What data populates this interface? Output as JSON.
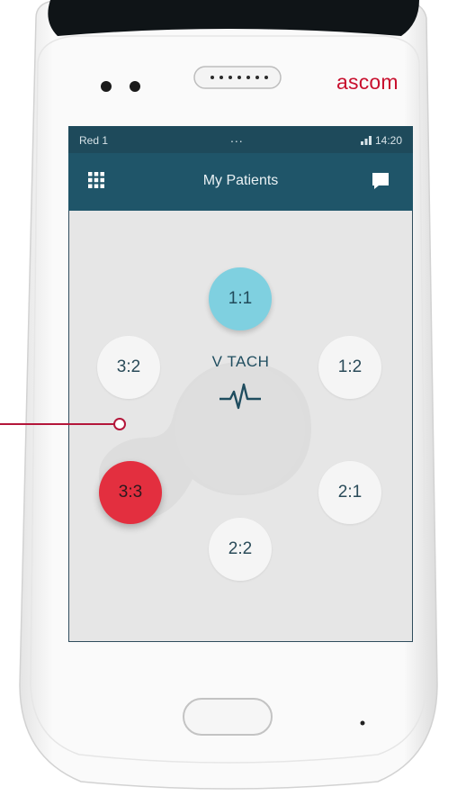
{
  "device": {
    "brand": "ascom",
    "brand_color": "#c8102e"
  },
  "status_bar": {
    "left": "Red 1",
    "middle": "...",
    "time": "14:20"
  },
  "app_bar": {
    "title": "My Patients",
    "left_icon": "grid-menu-icon",
    "right_icon": "chat-bubble-icon"
  },
  "alarm_hub": {
    "icon": "heartbeat-icon",
    "label": "V TACH"
  },
  "beds": [
    {
      "id": "1:1",
      "state": "active"
    },
    {
      "id": "3:2",
      "state": "normal"
    },
    {
      "id": "1:2",
      "state": "normal"
    },
    {
      "id": "3:3",
      "state": "alarm"
    },
    {
      "id": "2:1",
      "state": "normal"
    },
    {
      "id": "2:2",
      "state": "normal"
    }
  ],
  "colors": {
    "header_dark": "#1e4a5b",
    "header": "#1f5569",
    "active_bed": "#7fd0e0",
    "alarm_bed": "#e32f3f",
    "screen_bg": "#e6e6e6"
  }
}
